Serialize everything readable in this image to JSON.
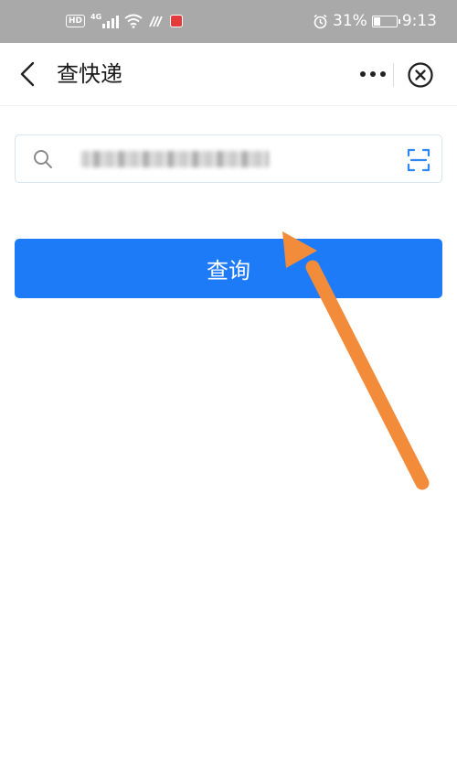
{
  "status_bar": {
    "hd": "HD",
    "network": "4G",
    "battery_text": "31%",
    "battery_level": 0.31,
    "time": "9:13"
  },
  "header": {
    "title": "查快递"
  },
  "search": {
    "placeholder": "",
    "value": ""
  },
  "query_button": {
    "label": "查询"
  },
  "colors": {
    "status_bar_bg": "#a9a9a9",
    "primary_button": "#1e7bf7",
    "annotation_arrow": "#f28c3a",
    "scan_icon": "#2e86f0"
  },
  "icons": {
    "back": "chevron-left-icon",
    "more": "more-dots-icon",
    "close": "close-circle-icon",
    "search": "search-icon",
    "scan": "scan-icon"
  }
}
